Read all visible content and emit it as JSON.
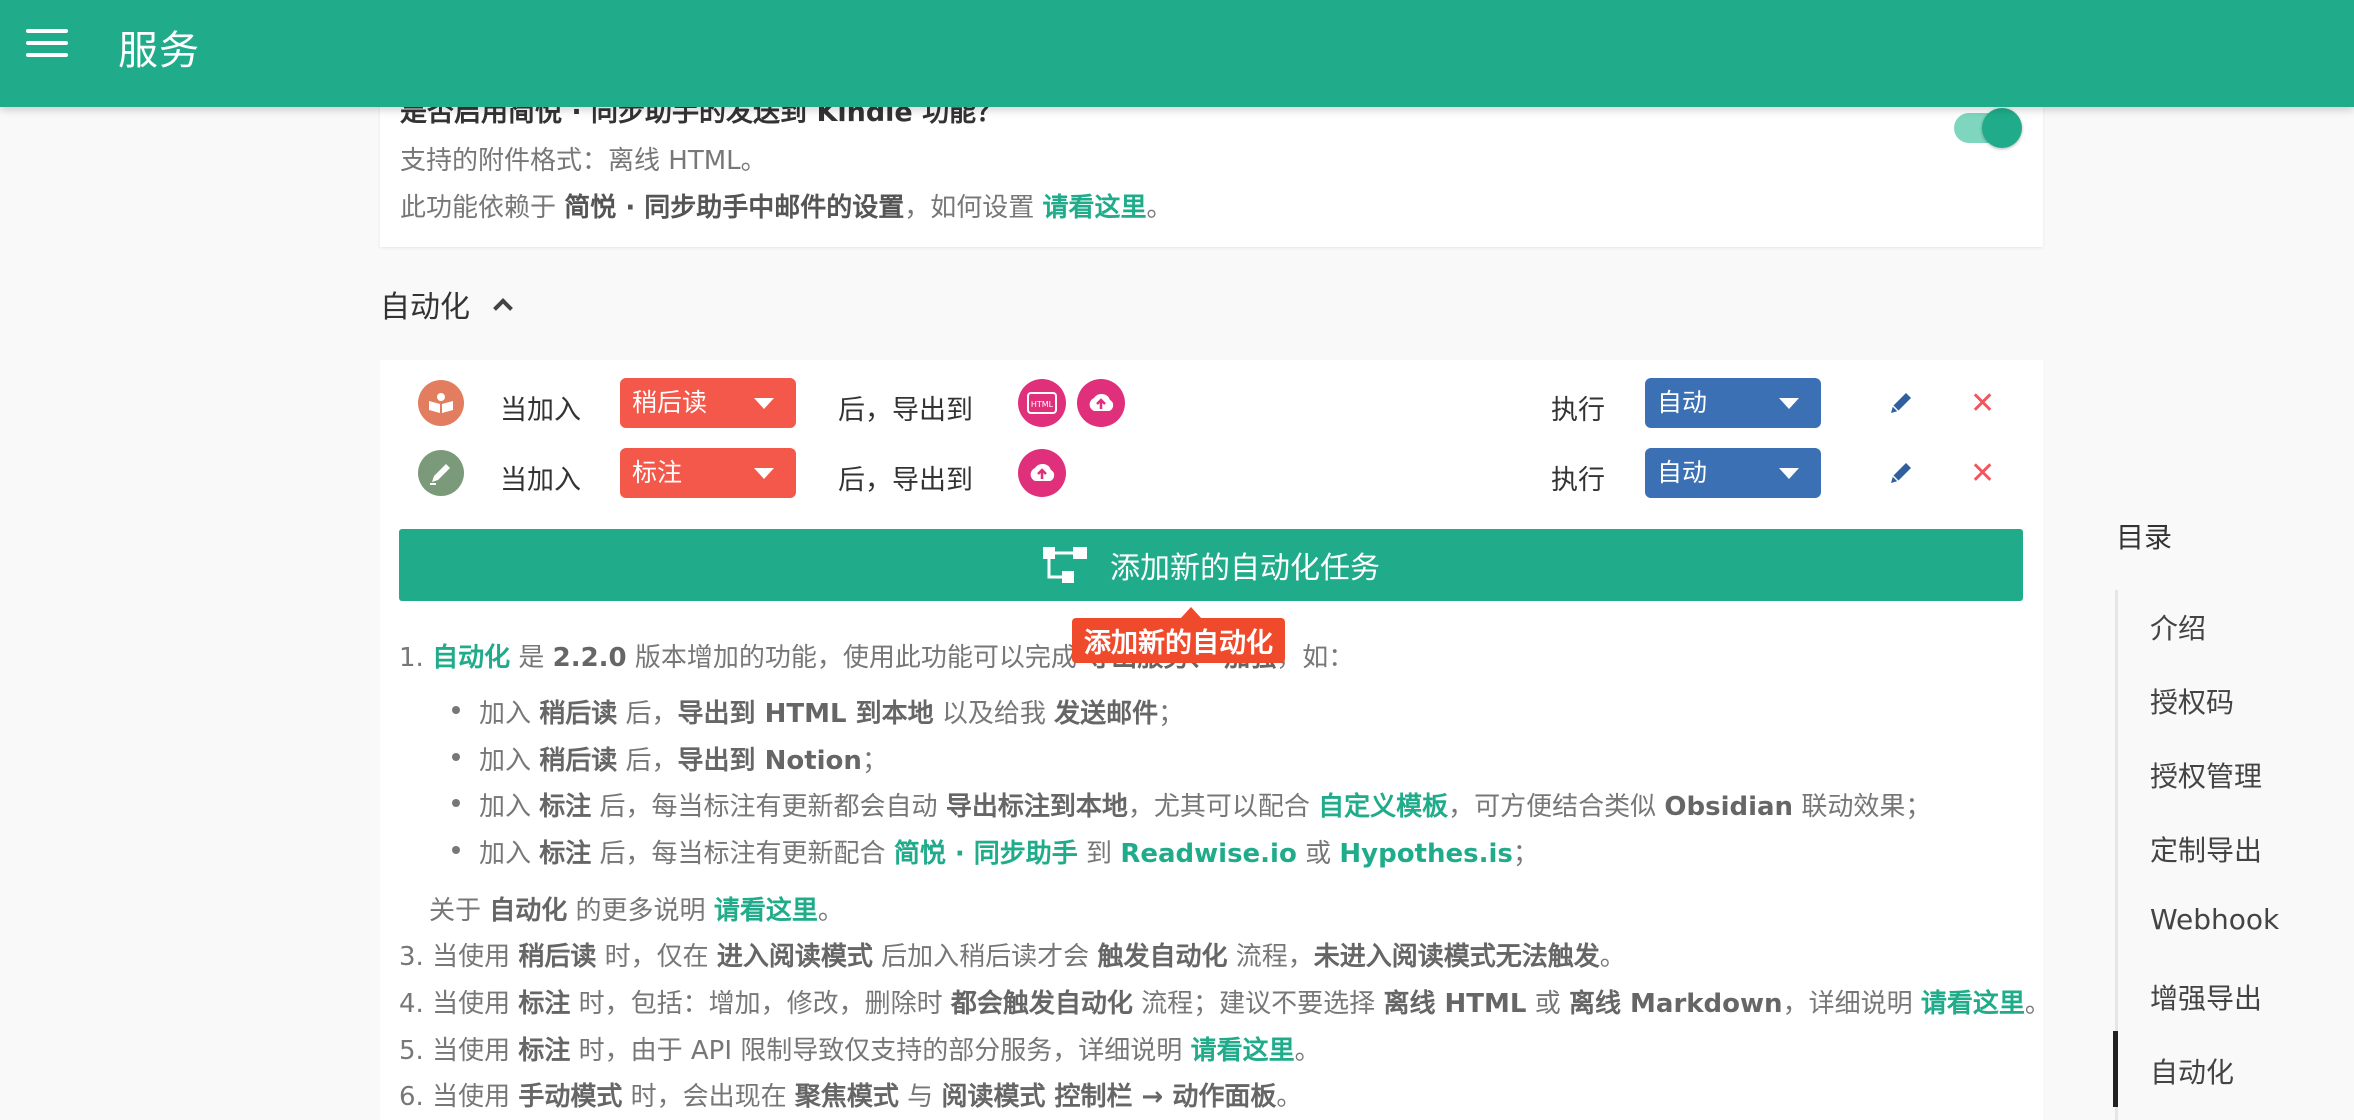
{
  "header": {
    "title": "服务",
    "menu_icon": "hamburger-menu-icon",
    "bg_color": "#20ac8a"
  },
  "kindle": {
    "question": "是否启用简悦 · 同步助手的发送到 Kindle 功能？",
    "formats": "支持的附件格式：离线 HTML。",
    "depends_prefix": "此功能依赖于 ",
    "depends_bold": "简悦 · 同步助手中邮件的设置",
    "depends_mid": "，如何设置 ",
    "depends_link": "请看这里",
    "depends_suffix": "。",
    "enabled": true
  },
  "automation": {
    "heading": "自动化",
    "rules": [
      {
        "icon": "book-icon",
        "when_label": "当加入",
        "source": "稍后读",
        "then_label": "后，导出到",
        "targets": [
          "html-export-icon",
          "cloud-upload-icon"
        ],
        "exec_label": "执行",
        "mode": "自动"
      },
      {
        "icon": "highlighter-icon",
        "when_label": "当加入",
        "source": "标注",
        "then_label": "后，导出到",
        "targets": [
          "cloud-upload-icon"
        ],
        "exec_label": "执行",
        "mode": "自动"
      }
    ],
    "add_button": "添加新的自动化任务",
    "tooltip": "添加新的自动化"
  },
  "notes": {
    "n1_prefix": "1. ",
    "n1_link": "自动化",
    "n1_mid": " 是 ",
    "n1_version": "2.2.0",
    "n1_rest": " 版本增加的功能，使用此功能可以完成 ",
    "n1_bold": "导出服务、 加强",
    "n1_end": "，如：",
    "b1": [
      "加入 ",
      "稍后读",
      " 后，",
      "导出到 HTML 到本地",
      " 以及给我 ",
      "发送邮件",
      "；"
    ],
    "b2": [
      "加入 ",
      "稍后读",
      " 后，",
      "导出到 Notion",
      "；"
    ],
    "b3": [
      "加入 ",
      "标注",
      " 后，每当标注有更新都会自动 ",
      "导出标注到本地",
      "，尤其可以配合 ",
      "自定义模板",
      "，可方便结合类似 ",
      "Obsidian",
      " 联动效果；"
    ],
    "b4": [
      "加入 ",
      "标注",
      " 后，每当标注有更新配合 ",
      "简悦 · 同步助手",
      " 到 ",
      "Readwise.io",
      " 或 ",
      "Hypothes.is",
      "；"
    ],
    "more": [
      "关于 ",
      "自动化",
      " 的更多说明 ",
      "请看这里",
      "。"
    ],
    "n3": [
      "3. 当使用 ",
      "稍后读",
      " 时，仅在 ",
      "进入阅读模式",
      " 后加入稍后读才会 ",
      "触发自动化",
      " 流程，",
      "未进入阅读模式无法触发",
      "。"
    ],
    "n4": [
      "4. 当使用 ",
      "标注",
      " 时，包括：增加，修改，删除时 ",
      "都会触发自动化",
      " 流程；建议不要选择 ",
      "离线 HTML",
      " 或 ",
      "离线 Markdown",
      "，详细说明 ",
      "请看这里",
      "。"
    ],
    "n5": [
      "5. 当使用 ",
      "标注",
      " 时，由于 API 限制导致仅支持的部分服务，详细说明 ",
      "请看这里",
      "。"
    ],
    "n6": [
      "6. 当使用 ",
      "手动模式",
      " 时，会出现在 ",
      "聚焦模式",
      " 与 ",
      "阅读模式 控制栏 → 动作面板",
      "。"
    ]
  },
  "toc": {
    "title": "目录",
    "items": [
      "介绍",
      "授权码",
      "授权管理",
      "定制导出",
      "Webhook",
      "增强导出",
      "自动化"
    ],
    "active": "自动化"
  }
}
